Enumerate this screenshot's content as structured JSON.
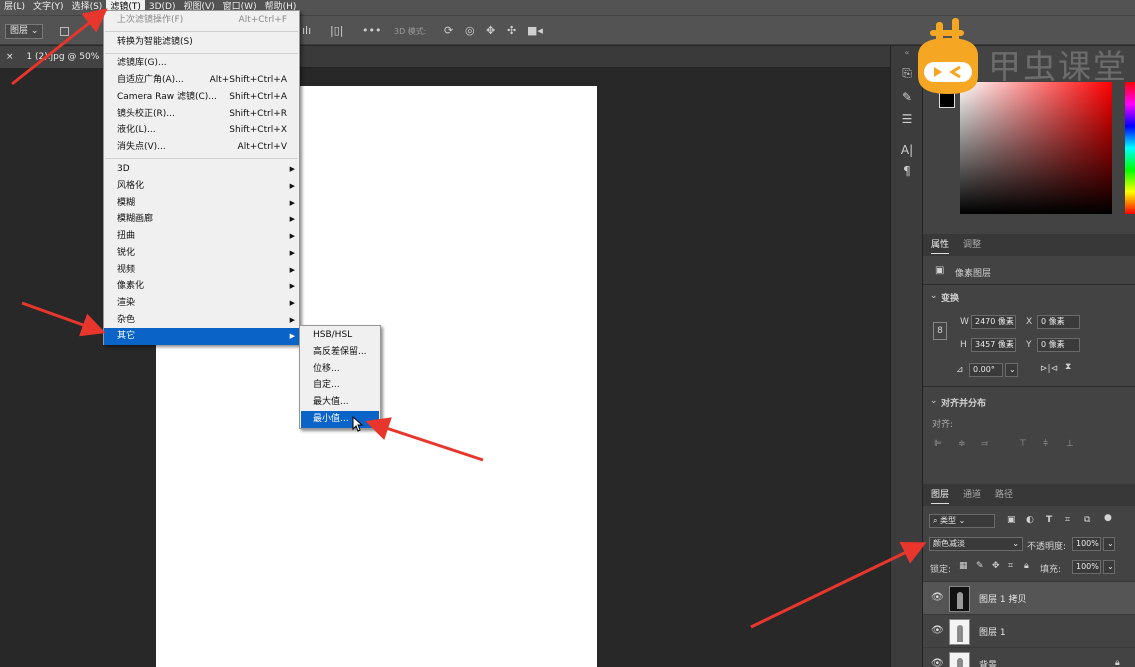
{
  "menubar": {
    "items": [
      {
        "label": "层(L)"
      },
      {
        "label": "文字(Y)"
      },
      {
        "label": "选择(S)"
      },
      {
        "label": "滤镜(T)"
      },
      {
        "label": "3D(D)"
      },
      {
        "label": "视图(V)"
      },
      {
        "label": "窗口(W)"
      },
      {
        "label": "帮助(H)"
      }
    ]
  },
  "options_bar": {
    "layer_dropdown": "图层",
    "mode_3d_label": "3D 模式:",
    "more_label": "•••"
  },
  "document_tab": {
    "label": "1 (2).jpg @ 50% (",
    "close": "×"
  },
  "filter_menu": {
    "items": [
      {
        "label": "上次滤镜操作(F)",
        "shortcut": "Alt+Ctrl+F",
        "disabled": true
      },
      {
        "label": "转换为智能滤镜(S)",
        "shortcut": ""
      },
      {
        "label": "滤镜库(G)...",
        "shortcut": ""
      },
      {
        "label": "自适应广角(A)...",
        "shortcut": "Alt+Shift+Ctrl+A"
      },
      {
        "label": "Camera Raw 滤镜(C)...",
        "shortcut": "Shift+Ctrl+A"
      },
      {
        "label": "镜头校正(R)...",
        "shortcut": "Shift+Ctrl+R"
      },
      {
        "label": "液化(L)...",
        "shortcut": "Shift+Ctrl+X"
      },
      {
        "label": "消失点(V)...",
        "shortcut": "Alt+Ctrl+V"
      },
      {
        "label": "3D"
      },
      {
        "label": "风格化"
      },
      {
        "label": "模糊"
      },
      {
        "label": "模糊画廊"
      },
      {
        "label": "扭曲"
      },
      {
        "label": "锐化"
      },
      {
        "label": "视频"
      },
      {
        "label": "像素化"
      },
      {
        "label": "渲染"
      },
      {
        "label": "杂色"
      },
      {
        "label": "其它",
        "highlighted": true
      }
    ]
  },
  "other_submenu": {
    "items": [
      {
        "label": "HSB/HSL"
      },
      {
        "label": "高反差保留..."
      },
      {
        "label": "位移..."
      },
      {
        "label": "自定..."
      },
      {
        "label": "最大值..."
      },
      {
        "label": "最小值...",
        "highlighted": true
      }
    ]
  },
  "logo": {
    "text": "甲虫课堂",
    "brand_color": "#f5a623"
  },
  "properties_panel": {
    "tabs": [
      "属性",
      "调整"
    ],
    "layer_type": "像素图层",
    "transform_title": "变换",
    "w_label": "W",
    "w_value": "2470 像素",
    "h_label": "H",
    "h_value": "3457 像素",
    "x_label": "X",
    "x_value": "0 像素",
    "y_label": "Y",
    "y_value": "0 像素",
    "angle_value": "0.00°",
    "align_title": "对齐并分布",
    "align_label": "对齐:"
  },
  "layers_panel": {
    "tabs": [
      "图层",
      "通道",
      "路径"
    ],
    "filter_kind": "类型",
    "blend_mode": "颜色减淡",
    "opacity_label": "不透明度:",
    "opacity_value": "100%",
    "lock_label": "锁定:",
    "fill_label": "填充:",
    "fill_value": "100%",
    "layers": [
      {
        "name": "图层 1 拷贝",
        "selected": true
      },
      {
        "name": "图层 1"
      },
      {
        "name": "背景"
      }
    ]
  },
  "colors": {
    "accent": "#0a64c8",
    "arrow": "#e8362c",
    "panel_bg": "#434343",
    "canvas_bg": "#282828"
  }
}
